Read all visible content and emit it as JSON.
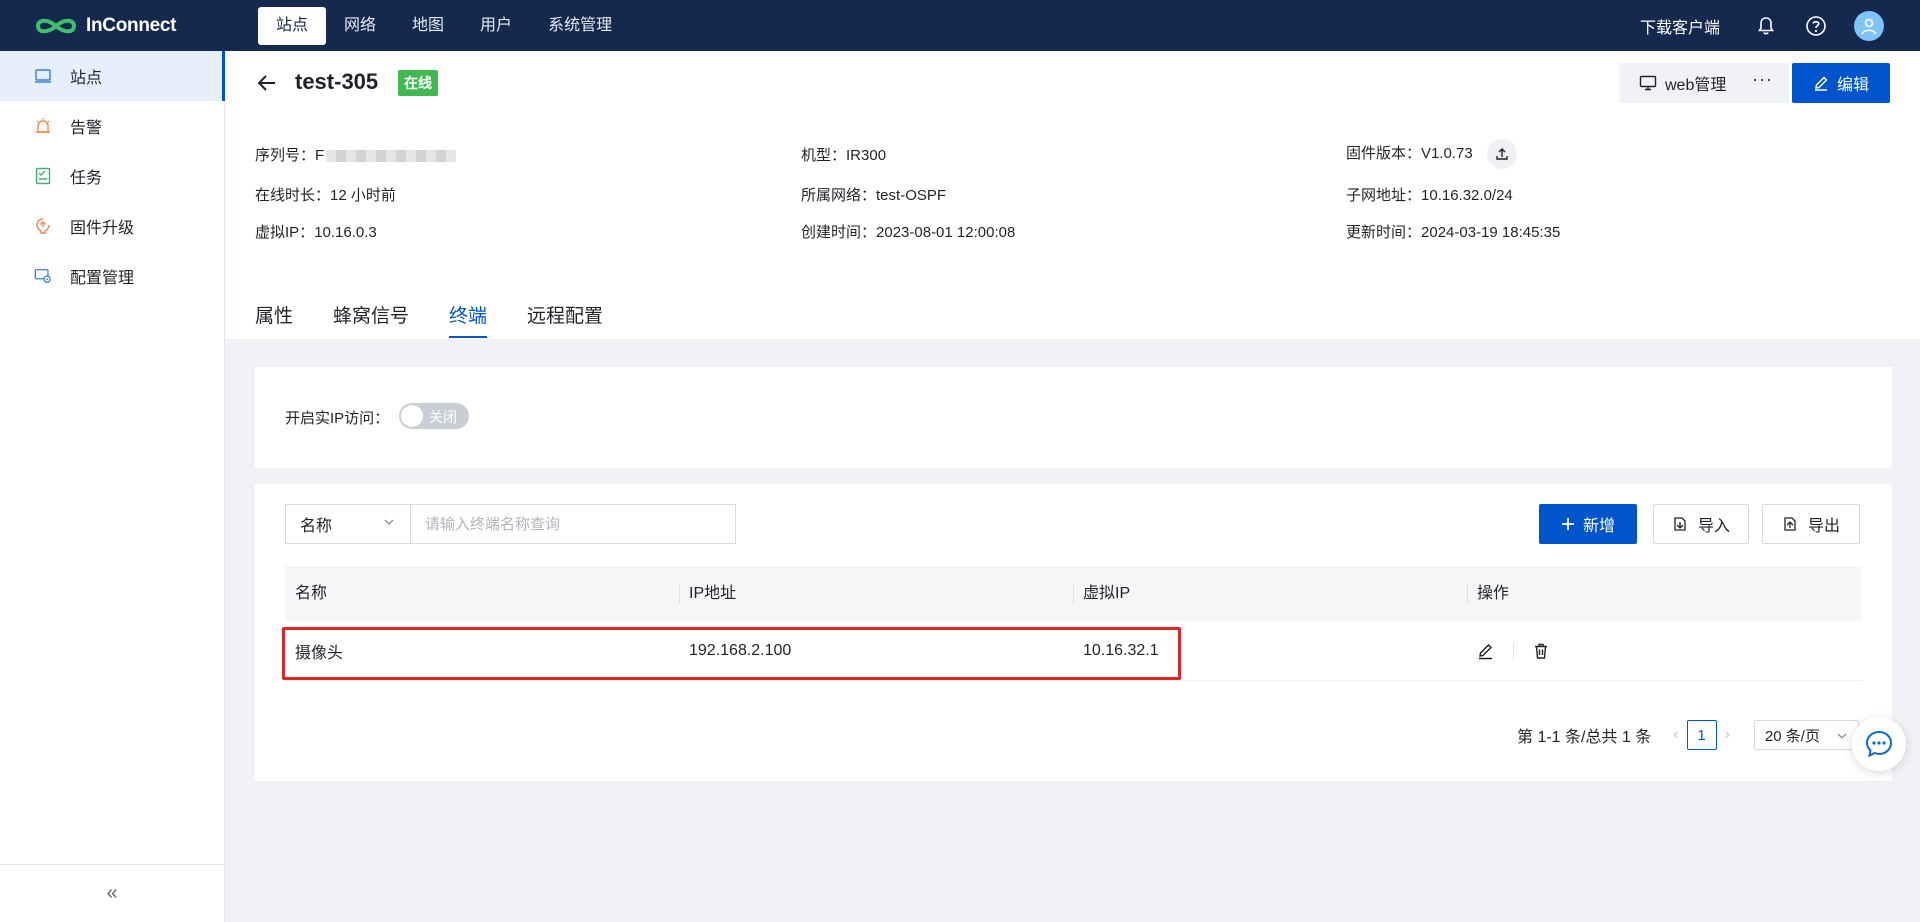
{
  "brand": {
    "name": "InConnect"
  },
  "nav": {
    "items": [
      "站点",
      "网络",
      "地图",
      "用户",
      "系统管理"
    ],
    "active_index": 0
  },
  "top_right": {
    "download_label": "下载客户端"
  },
  "sidebar": {
    "items": [
      {
        "label": "站点",
        "icon": "site-icon",
        "active": true
      },
      {
        "label": "告警",
        "icon": "alarm-icon"
      },
      {
        "label": "任务",
        "icon": "task-icon"
      },
      {
        "label": "固件升级",
        "icon": "firmware-icon"
      },
      {
        "label": "配置管理",
        "icon": "config-icon"
      }
    ],
    "collapse_glyph": "«"
  },
  "device": {
    "name": "test-305",
    "status": "在线",
    "actions": {
      "web_label": "web管理",
      "more_label": "···",
      "edit_label": "编辑"
    },
    "info": {
      "serial_label": "序列号：",
      "serial_value": "F",
      "model_label": "机型：",
      "model_value": "IR300",
      "firmware_label": "固件版本：",
      "firmware_value": "V1.0.73",
      "uptime_label": "在线时长：",
      "uptime_value": "12 小时前",
      "network_label": "所属网络：",
      "network_value": "test-OSPF",
      "subnet_label": "子网地址：",
      "subnet_value": "10.16.32.0/24",
      "vip_label": "虚拟IP：",
      "vip_value": "10.16.0.3",
      "created_label": "创建时间：",
      "created_value": "2023-08-01 12:00:08",
      "updated_label": "更新时间：",
      "updated_value": "2024-03-19 18:45:35"
    }
  },
  "tabs": [
    "属性",
    "蜂窝信号",
    "终端",
    "远程配置"
  ],
  "active_tab": 2,
  "real_ip": {
    "label": "开启实IP访问：",
    "toggle_text": "关闭",
    "enabled": false
  },
  "toolbar": {
    "filter_field": "名称",
    "search_placeholder": "请输入终端名称查询",
    "add_label": "新增",
    "import_label": "导入",
    "export_label": "导出"
  },
  "table": {
    "columns": [
      "名称",
      "IP地址",
      "虚拟IP",
      "操作"
    ],
    "rows": [
      {
        "name": "摄像头",
        "ip": "192.168.2.100",
        "vip": "10.16.32.1"
      }
    ]
  },
  "pagination": {
    "summary": "第 1-1 条/总共 1 条",
    "current": "1",
    "page_size": "20 条/页"
  },
  "colors": {
    "primary": "#0055cc",
    "topbar": "#15284d",
    "online": "#3fb950",
    "highlight": "#e02424"
  }
}
